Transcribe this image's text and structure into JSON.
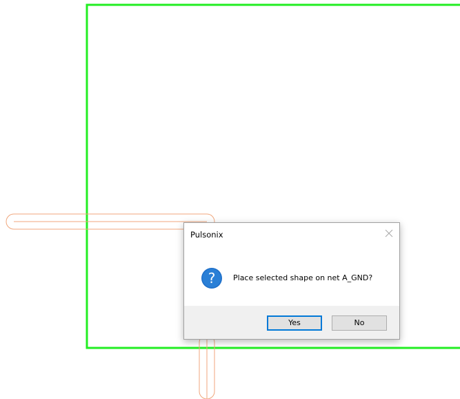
{
  "dialog": {
    "title": "Pulsonix",
    "message": "Place selected shape on net A_GND?",
    "icon": "question-icon",
    "buttons": {
      "yes": "Yes",
      "no": "No"
    }
  },
  "colors": {
    "board_outline": "#22ee22",
    "track_outline": "#f0a67c",
    "dialog_accent": "#0078d7",
    "question_icon_fill": "#1e6fc9"
  }
}
